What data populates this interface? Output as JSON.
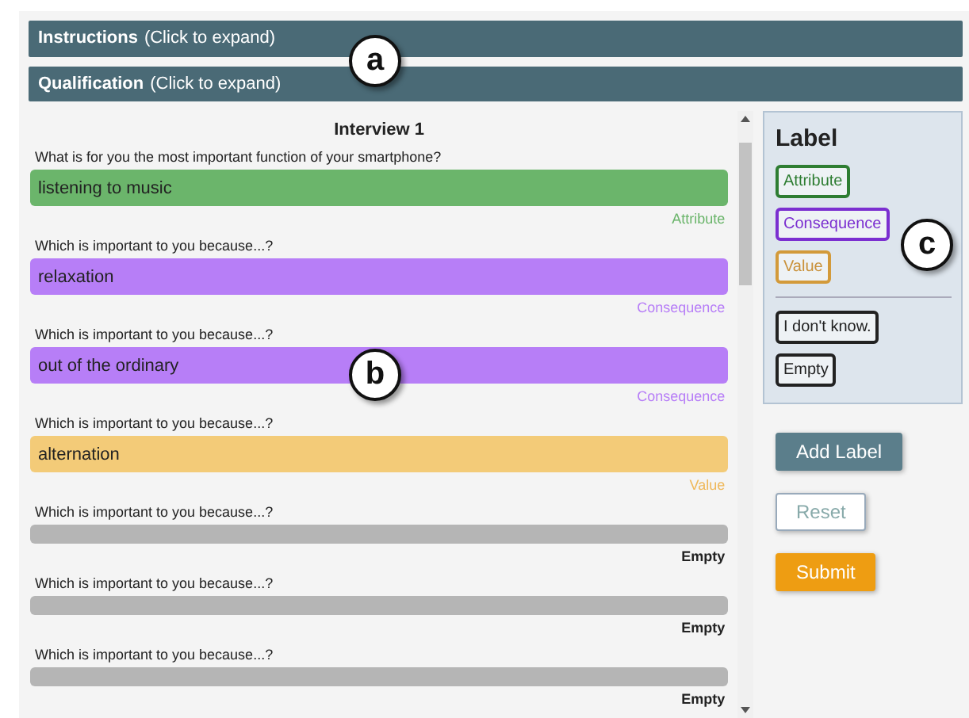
{
  "sections": [
    {
      "title": "Instructions",
      "hint": "(Click to expand)"
    },
    {
      "title": "Qualification",
      "hint": "(Click to expand)"
    }
  ],
  "interview": {
    "title": "Interview 1",
    "items": [
      {
        "question": "What is for you the most important function of your smartphone?",
        "answer": "listening to music",
        "kind": "attribute",
        "label": "Attribute"
      },
      {
        "question": "Which is important to you because...?",
        "answer": "relaxation",
        "kind": "consequence",
        "label": "Consequence"
      },
      {
        "question": "Which is important to you because...?",
        "answer": "out of the ordinary",
        "kind": "consequence",
        "label": "Consequence"
      },
      {
        "question": "Which is important to you because...?",
        "answer": "alternation",
        "kind": "value",
        "label": "Value"
      },
      {
        "question": "Which is important to you because...?",
        "kind": "empty",
        "label": "Empty"
      },
      {
        "question": "Which is important to you because...?",
        "kind": "empty",
        "label": "Empty"
      },
      {
        "question": "Which is important to you because...?",
        "kind": "empty",
        "label": "Empty"
      }
    ]
  },
  "label_panel": {
    "title": "Label",
    "options": [
      {
        "text": "Attribute",
        "kind": "attribute"
      },
      {
        "text": "Consequence",
        "kind": "consequence"
      },
      {
        "text": "Value",
        "kind": "value"
      }
    ],
    "extra_options": [
      {
        "text": "I don't know.",
        "kind": "other"
      },
      {
        "text": "Empty",
        "kind": "other"
      }
    ]
  },
  "buttons": [
    {
      "text": "Add Label",
      "kind": "primary"
    },
    {
      "text": "Reset",
      "kind": "outline"
    },
    {
      "text": "Submit",
      "kind": "submit"
    }
  ],
  "callouts": [
    {
      "text": "a"
    },
    {
      "text": "b"
    },
    {
      "text": "c"
    }
  ]
}
